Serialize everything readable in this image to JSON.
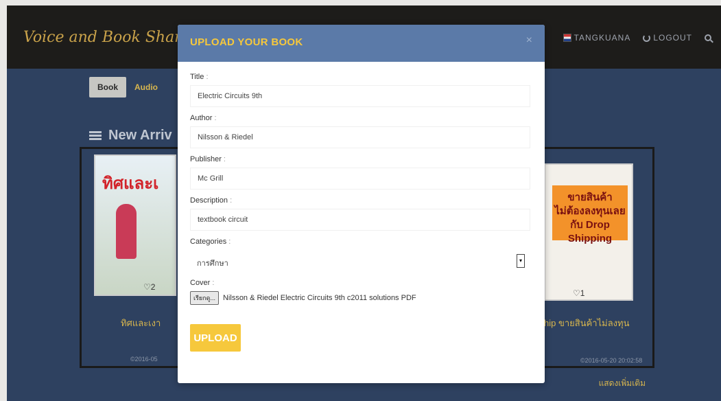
{
  "site": {
    "brand": "Voice and Book Sharing",
    "nav": {
      "user": "TANGKUANA",
      "logout": "LOGOUT"
    },
    "tabs": [
      "Book",
      "Audio"
    ],
    "section_title": "New Arriv",
    "cards": [
      {
        "caption": "ทิศและเงา",
        "likes": "2",
        "date": "2016-05",
        "cover_title": "ทิศและเ"
      },
      {
        "caption": "hip ขายสินค้าไม่ลงทุน",
        "likes": "1",
        "date": "2016-05-20 20:02:58",
        "cover_lines": "ขายสินค้า\nไม่ต้องลงทุนเลย\nกับ Drop Shipping"
      }
    ],
    "more_link": "แสดงเพิ่มเติม"
  },
  "modal": {
    "title": "UPLOAD YOUR BOOK",
    "close": "×",
    "fields": {
      "title": {
        "label": "Title",
        "value": "Electric Circuits 9th"
      },
      "author": {
        "label": "Author",
        "value": "Nilsson & Riedel"
      },
      "publisher": {
        "label": "Publisher",
        "value": "Mc Grill"
      },
      "description": {
        "label": "Description",
        "value": "textbook circuit"
      },
      "categories": {
        "label": "Categories",
        "value": "การศึกษา"
      },
      "cover": {
        "label": "Cover",
        "browse": "เรียกดู...",
        "file_name": "Nilsson & Riedel Electric Circuits 9th c2011 solutions PDF"
      }
    },
    "submit": "UPLOAD"
  }
}
